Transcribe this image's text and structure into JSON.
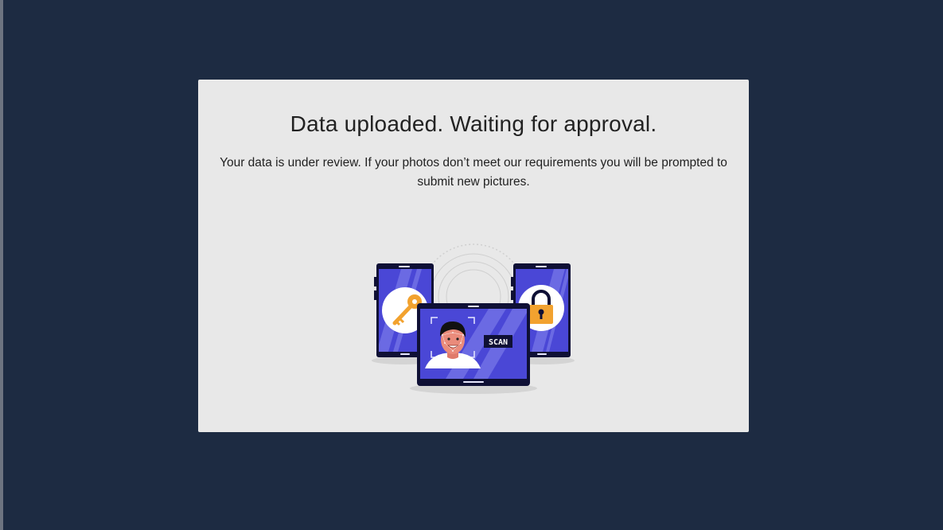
{
  "card": {
    "title": "Data uploaded. Waiting for approval.",
    "message": "Your data is under review. If your photos don’t meet our requirements you will be prompted to submit new pictures."
  },
  "illustration": {
    "scan_label": "SCAN",
    "icons": [
      "key-icon",
      "padlock-icon",
      "face-scan-icon"
    ],
    "colors": {
      "screen": "#4a47d6",
      "frame": "#0f1035",
      "accent": "#f2a22f",
      "background": "#1d2b42",
      "card": "#e8e8e8"
    }
  }
}
